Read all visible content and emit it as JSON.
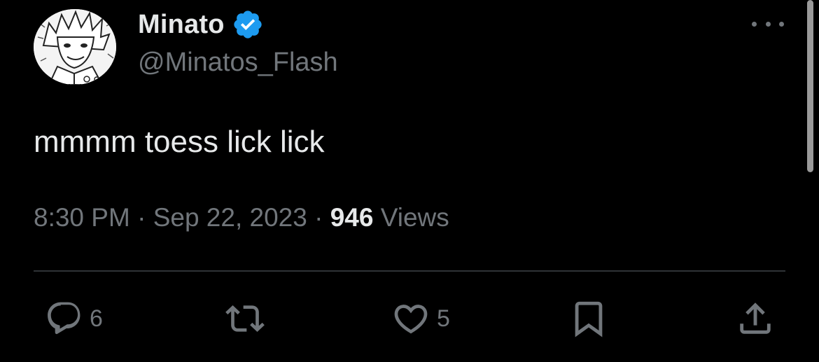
{
  "author": {
    "display_name": "Minato",
    "handle": "@Minatos_Flash",
    "verified": true,
    "verified_color": "#1d9bf0",
    "avatar_icon": "avatar-manga-portrait"
  },
  "tweet": {
    "text": "mmmm toess lick lick",
    "time": "8:30 PM",
    "separator": "·",
    "date": "Sep 22, 2023",
    "views_count": "946",
    "views_label": "Views"
  },
  "actions": {
    "reply": {
      "icon": "reply-icon",
      "count": "6"
    },
    "retweet": {
      "icon": "retweet-icon"
    },
    "like": {
      "icon": "heart-icon",
      "count": "5"
    },
    "bookmark": {
      "icon": "bookmark-icon"
    },
    "share": {
      "icon": "share-icon"
    }
  },
  "colors": {
    "background": "#000000",
    "primary_text": "#e7e9ea",
    "secondary_text": "#71767b",
    "divider": "#2f3336"
  }
}
